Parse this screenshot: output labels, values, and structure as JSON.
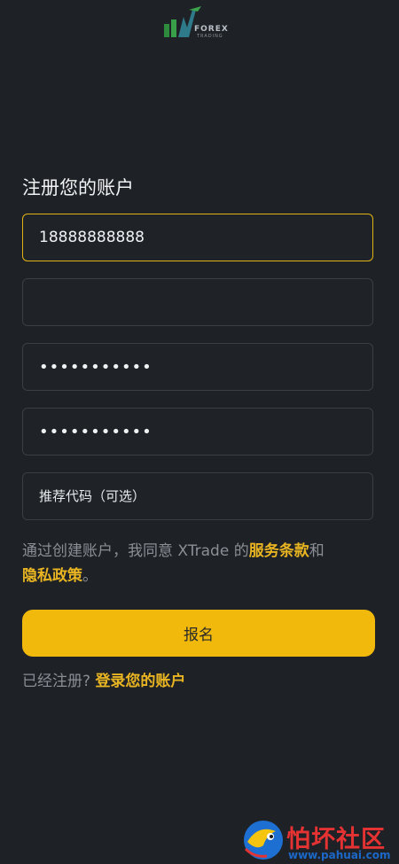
{
  "logo": {
    "line1": "FOREX",
    "line2": "TRADING"
  },
  "form": {
    "title": "注册您的账户",
    "phone_value": "18888888888",
    "code_value": "",
    "password_value": "•••••••••••",
    "confirm_value": "•••••••••••",
    "referral_placeholder": "推荐代码（可选）"
  },
  "terms": {
    "prefix": "通过创建账户，我同意 XTrade 的",
    "service_link": "服务条款",
    "and": "和",
    "privacy_link": "隐私政策",
    "suffix": "。"
  },
  "actions": {
    "signup_label": "报名",
    "already_text": "已经注册?",
    "login_link": "登录您的账户"
  },
  "watermark": {
    "name": "怕坏社区",
    "url": "www.pahuai.com"
  },
  "colors": {
    "accent": "#f0b90b",
    "background": "#1e2125",
    "link": "#e9b522"
  }
}
